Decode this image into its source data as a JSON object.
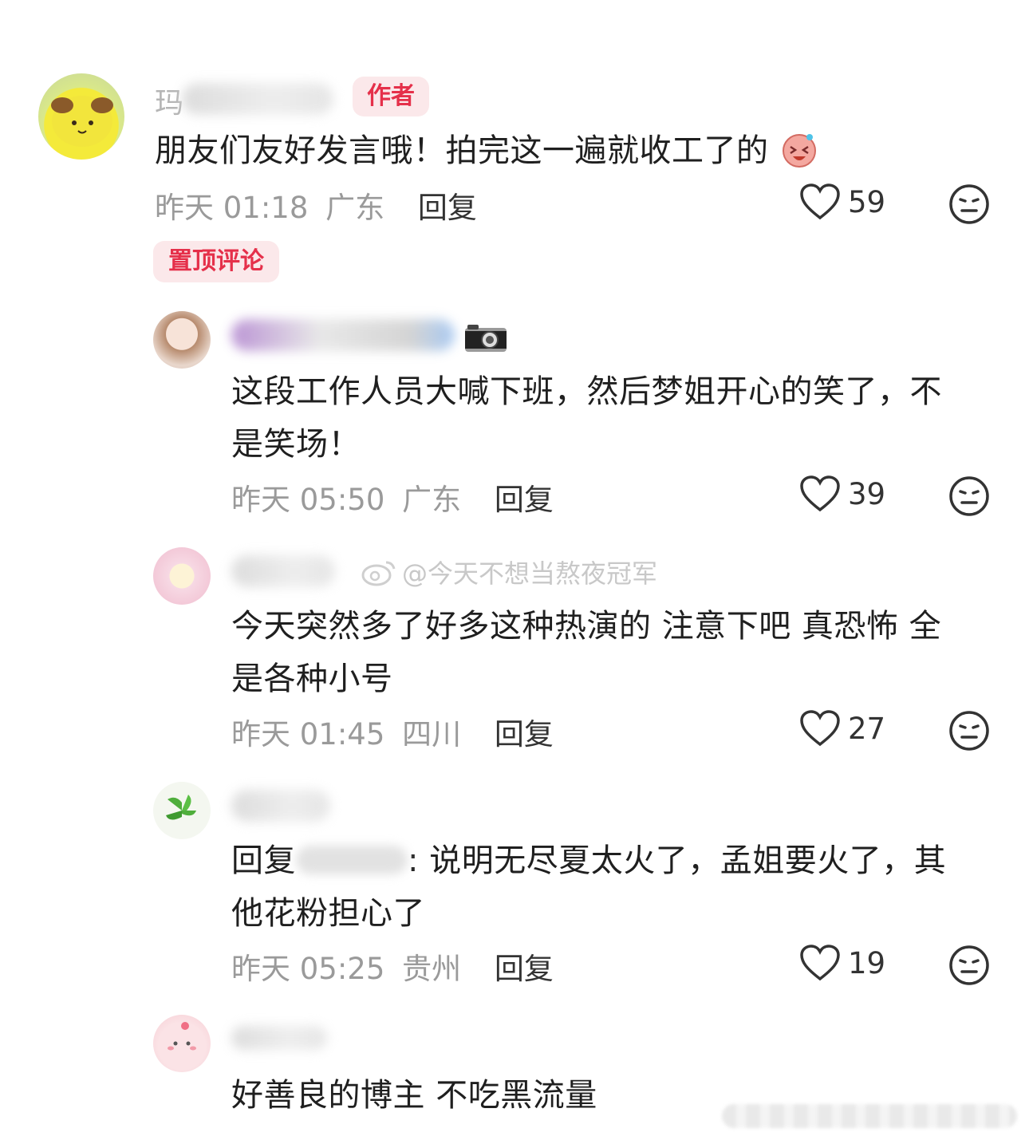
{
  "author_comment": {
    "name_visible": "玛",
    "author_badge": "作者",
    "text": "朋友们友好发言哦！拍完这一遍就收工了的",
    "time": "昨天 01:18",
    "location": "广东",
    "reply_label": "回复",
    "likes": "59",
    "pinned_label": "置顶评论"
  },
  "replies": [
    {
      "text_line1": "这段工作人员大喊下班，然后梦姐开心的笑了，不",
      "text_line2": "是笑场！",
      "time": "昨天 05:50",
      "location": "广东",
      "reply_label": "回复",
      "likes": "39"
    },
    {
      "text_line1": "今天突然多了好多这种热演的 注意下吧 真恐怖 全",
      "text_line2": "是各种小号",
      "time": "昨天 01:45",
      "location": "四川",
      "reply_label": "回复",
      "likes": "27"
    },
    {
      "reply_prefix": "回复",
      "text_line1_after": ": 说明无尽夏太火了，孟姐要火了，其",
      "text_line2": "他花粉担心了",
      "time": "昨天 05:25",
      "location": "贵州",
      "reply_label": "回复",
      "likes": "19"
    },
    {
      "text_line1": "好善良的博主 不吃黑流量"
    }
  ],
  "watermark": "@今天不想当熬夜冠军",
  "icons": {
    "like": "heart-outline-icon",
    "dislike": "neutral-face-icon",
    "camera": "camera-icon",
    "weibo": "weibo-logo-icon"
  },
  "colors": {
    "badge_bg": "#fbe8ea",
    "badge_text": "#e5304a",
    "meta_gray": "#9a9a9a"
  }
}
